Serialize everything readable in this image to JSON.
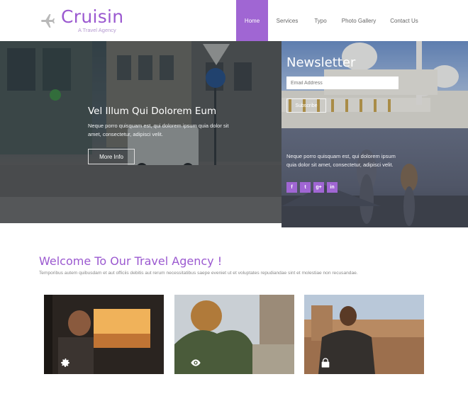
{
  "brand": {
    "title": "Cruisin",
    "subtitle": "A Travel Agency",
    "icon": "airplane-icon",
    "accent_color": "#a066d3"
  },
  "nav": {
    "items": [
      {
        "label": "Home",
        "active": true
      },
      {
        "label": "Services",
        "active": false
      },
      {
        "label": "Typo",
        "active": false
      },
      {
        "label": "Photo Gallery",
        "active": false
      },
      {
        "label": "Contact Us",
        "active": false
      }
    ]
  },
  "hero": {
    "title": "Vel Illum Qui Dolorem Eum",
    "text": "Neque porro quisquam est, qui dolorem ipsum quia dolor sit amet, consectetur, adipisci velit.",
    "button": "More Info"
  },
  "newsletter": {
    "title": "Newsletter",
    "placeholder": "Email Address",
    "button": "Subscribe"
  },
  "social": {
    "text": "Neque porro quisquam est, qui dolorem ipsum quia dolor sit amet, consectetur, adipisci velit.",
    "icons": [
      {
        "name": "facebook-icon",
        "glyph": "f"
      },
      {
        "name": "twitter-icon",
        "glyph": "t"
      },
      {
        "name": "google-plus-icon",
        "glyph": "g+"
      },
      {
        "name": "linkedin-icon",
        "glyph": "in"
      }
    ]
  },
  "welcome": {
    "title": "Welcome To Our Travel Agency !",
    "text": "Temporibus autem quibusdam et aut officiis debitis aut rerum necessitatibus saepe eveniet ut et voluptates repudiandae sint et molestiae non recusandae."
  },
  "cards": [
    {
      "icon": "gear-icon"
    },
    {
      "icon": "eye-icon"
    },
    {
      "icon": "lock-icon"
    }
  ]
}
